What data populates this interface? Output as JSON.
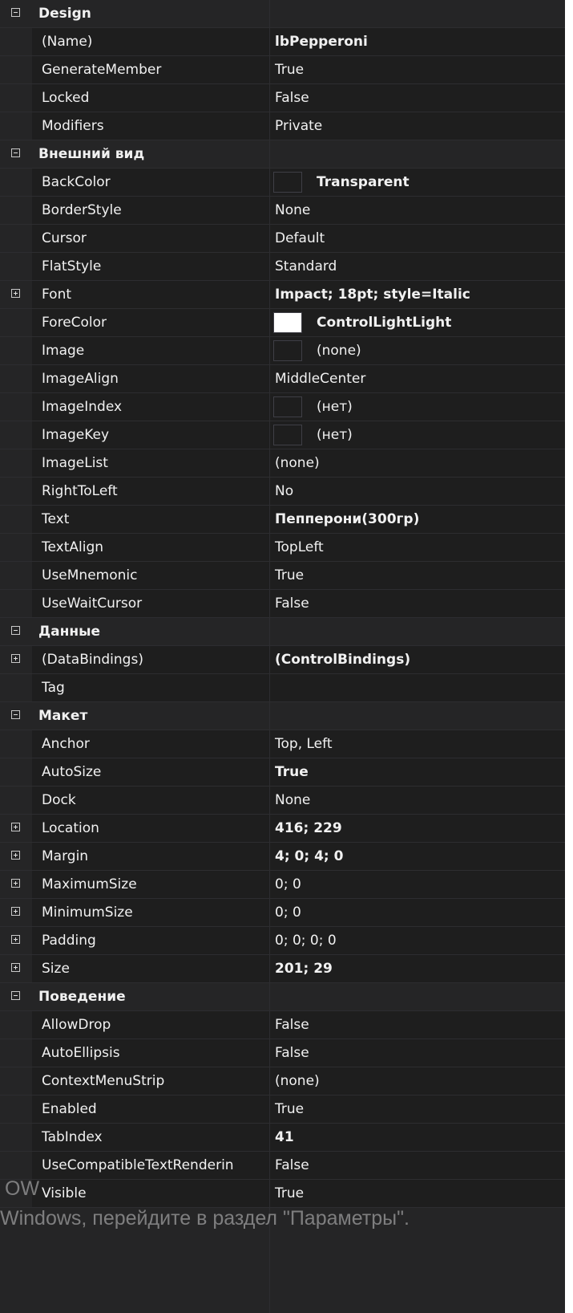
{
  "rows": [
    {
      "kind": "cat",
      "name": "Design",
      "exp": "minus"
    },
    {
      "name": "(Name)",
      "value": "lbPepperoni",
      "bold": true
    },
    {
      "name": "GenerateMember",
      "value": "True"
    },
    {
      "name": "Locked",
      "value": "False"
    },
    {
      "name": "Modifiers",
      "value": "Private"
    },
    {
      "kind": "cat",
      "name": "Внешний вид",
      "exp": "minus"
    },
    {
      "name": "BackColor",
      "value": "Transparent",
      "bold": true,
      "swatch": "#1e1e1e"
    },
    {
      "name": "BorderStyle",
      "value": "None"
    },
    {
      "name": "Cursor",
      "value": "Default"
    },
    {
      "name": "FlatStyle",
      "value": "Standard"
    },
    {
      "name": "Font",
      "value": "Impact; 18pt; style=Italic",
      "bold": true,
      "exp": "plus"
    },
    {
      "name": "ForeColor",
      "value": "ControlLightLight",
      "bold": true,
      "swatch": "#ffffff"
    },
    {
      "name": "Image",
      "value": "(none)",
      "swatch": "#1e1e1e"
    },
    {
      "name": "ImageAlign",
      "value": "MiddleCenter"
    },
    {
      "name": "ImageIndex",
      "value": "(нет)",
      "swatch": "#1e1e1e"
    },
    {
      "name": "ImageKey",
      "value": "(нет)",
      "swatch": "#1e1e1e"
    },
    {
      "name": "ImageList",
      "value": "(none)"
    },
    {
      "name": "RightToLeft",
      "value": "No"
    },
    {
      "name": "Text",
      "value": "Пепперони(300гр)",
      "bold": true
    },
    {
      "name": "TextAlign",
      "value": "TopLeft"
    },
    {
      "name": "UseMnemonic",
      "value": "True"
    },
    {
      "name": "UseWaitCursor",
      "value": "False"
    },
    {
      "kind": "cat",
      "name": "Данные",
      "exp": "minus"
    },
    {
      "name": "(DataBindings)",
      "value": "(ControlBindings)",
      "bold": true,
      "exp": "plus"
    },
    {
      "name": "Tag",
      "value": ""
    },
    {
      "kind": "cat",
      "name": "Макет",
      "exp": "minus"
    },
    {
      "name": "Anchor",
      "value": "Top, Left"
    },
    {
      "name": "AutoSize",
      "value": "True",
      "bold": true
    },
    {
      "name": "Dock",
      "value": "None"
    },
    {
      "name": "Location",
      "value": "416; 229",
      "bold": true,
      "exp": "plus"
    },
    {
      "name": "Margin",
      "value": "4; 0; 4; 0",
      "bold": true,
      "exp": "plus"
    },
    {
      "name": "MaximumSize",
      "value": "0; 0",
      "exp": "plus"
    },
    {
      "name": "MinimumSize",
      "value": "0; 0",
      "exp": "plus"
    },
    {
      "name": "Padding",
      "value": "0; 0; 0; 0",
      "exp": "plus"
    },
    {
      "name": "Size",
      "value": "201; 29",
      "bold": true,
      "exp": "plus"
    },
    {
      "kind": "cat",
      "name": "Поведение",
      "exp": "minus"
    },
    {
      "name": "AllowDrop",
      "value": "False"
    },
    {
      "name": "AutoEllipsis",
      "value": "False"
    },
    {
      "name": "ContextMenuStrip",
      "value": "(none)"
    },
    {
      "name": "Enabled",
      "value": "True"
    },
    {
      "name": "TabIndex",
      "value": "41",
      "bold": true
    },
    {
      "name": "UseCompatibleTextRenderin",
      "value": "False"
    },
    {
      "name": "Visible",
      "value": "True"
    }
  ],
  "watermark": {
    "line1": "OW",
    "line2": "Windows, перейдите в раздел \"Параметры\"."
  },
  "colors": {
    "grid_bg": "#252526",
    "cell_bg": "#1e1e1e",
    "text": "#f1f1f1"
  }
}
